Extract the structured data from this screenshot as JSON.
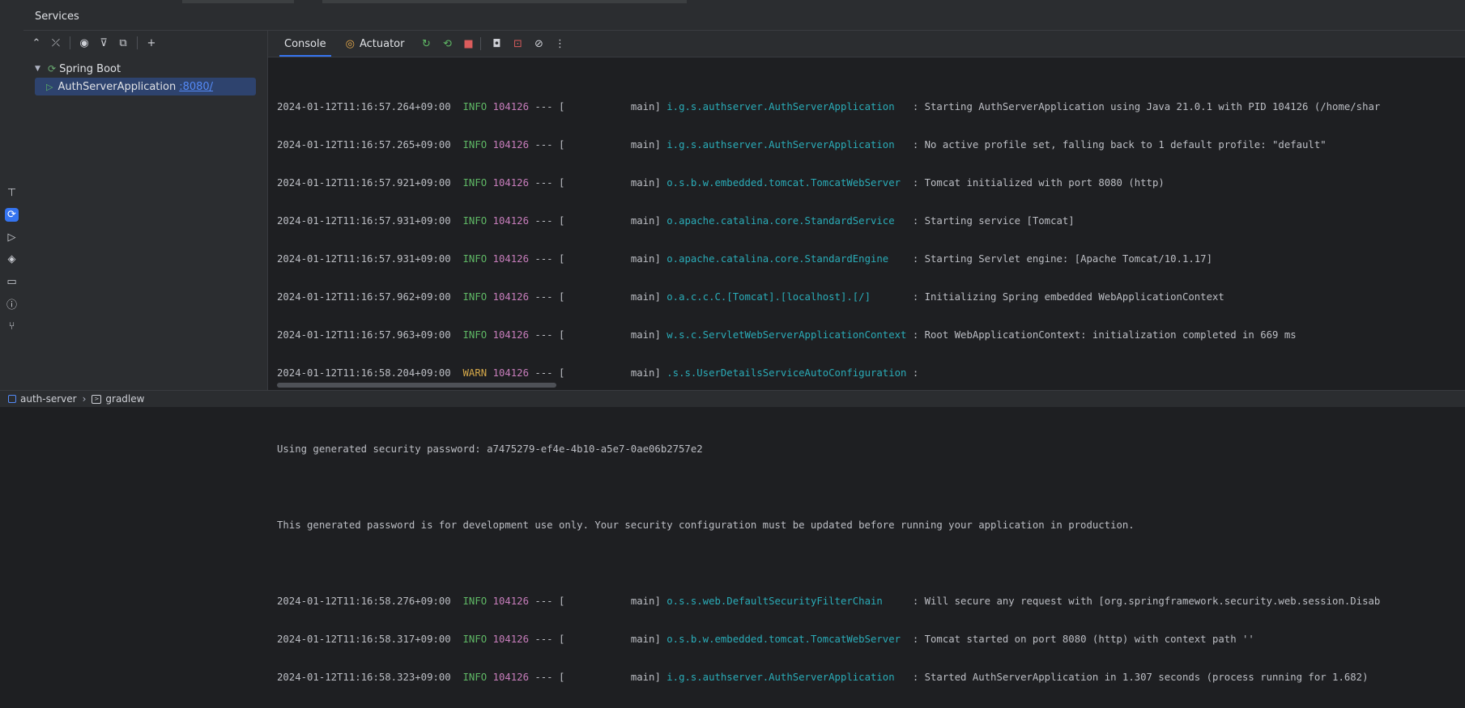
{
  "header": {
    "title": "Services"
  },
  "tree": {
    "root_label": "Spring Boot",
    "app_label": "AuthServerApplication",
    "app_port": ":8080/"
  },
  "tabs": {
    "console": "Console",
    "actuator": "Actuator"
  },
  "log_lines": [
    {
      "ts": "2024-01-12T11:16:57.264+09:00",
      "level": "INFO",
      "pid": "104126",
      "sep": "---",
      "thread": "[           main]",
      "logger": "i.g.s.authserver.AuthServerApplication  ",
      "msg": ": Starting AuthServerApplication using Java 21.0.1 with PID 104126 (/home/shar"
    },
    {
      "ts": "2024-01-12T11:16:57.265+09:00",
      "level": "INFO",
      "pid": "104126",
      "sep": "---",
      "thread": "[           main]",
      "logger": "i.g.s.authserver.AuthServerApplication  ",
      "msg": ": No active profile set, falling back to 1 default profile: \"default\""
    },
    {
      "ts": "2024-01-12T11:16:57.921+09:00",
      "level": "INFO",
      "pid": "104126",
      "sep": "---",
      "thread": "[           main]",
      "logger": "o.s.b.w.embedded.tomcat.TomcatWebServer ",
      "msg": ": Tomcat initialized with port 8080 (http)"
    },
    {
      "ts": "2024-01-12T11:16:57.931+09:00",
      "level": "INFO",
      "pid": "104126",
      "sep": "---",
      "thread": "[           main]",
      "logger": "o.apache.catalina.core.StandardService  ",
      "msg": ": Starting service [Tomcat]"
    },
    {
      "ts": "2024-01-12T11:16:57.931+09:00",
      "level": "INFO",
      "pid": "104126",
      "sep": "---",
      "thread": "[           main]",
      "logger": "o.apache.catalina.core.StandardEngine   ",
      "msg": ": Starting Servlet engine: [Apache Tomcat/10.1.17]"
    },
    {
      "ts": "2024-01-12T11:16:57.962+09:00",
      "level": "INFO",
      "pid": "104126",
      "sep": "---",
      "thread": "[           main]",
      "logger": "o.a.c.c.C.[Tomcat].[localhost].[/]      ",
      "msg": ": Initializing Spring embedded WebApplicationContext"
    },
    {
      "ts": "2024-01-12T11:16:57.963+09:00",
      "level": "INFO",
      "pid": "104126",
      "sep": "---",
      "thread": "[           main]",
      "logger": "w.s.c.ServletWebServerApplicationContext",
      "msg": ": Root WebApplicationContext: initialization completed in 669 ms"
    },
    {
      "ts": "2024-01-12T11:16:58.204+09:00",
      "level": "WARN",
      "pid": "104126",
      "sep": "---",
      "thread": "[           main]",
      "logger": ".s.s.UserDetailsServiceAutoConfiguration",
      "msg": ":"
    }
  ],
  "plain_lines": {
    "password": "Using generated security password: a7475279-ef4e-4b10-a5e7-0ae06b2757e2",
    "notice": "This generated password is for development use only. Your security configuration must be updated before running your application in production."
  },
  "log_lines_2": [
    {
      "ts": "2024-01-12T11:16:58.276+09:00",
      "level": "INFO",
      "pid": "104126",
      "sep": "---",
      "thread": "[           main]",
      "logger": "o.s.s.web.DefaultSecurityFilterChain    ",
      "msg": ": Will secure any request with [org.springframework.security.web.session.Disab"
    },
    {
      "ts": "2024-01-12T11:16:58.317+09:00",
      "level": "INFO",
      "pid": "104126",
      "sep": "---",
      "thread": "[           main]",
      "logger": "o.s.b.w.embedded.tomcat.TomcatWebServer ",
      "msg": ": Tomcat started on port 8080 (http) with context path ''"
    },
    {
      "ts": "2024-01-12T11:16:58.323+09:00",
      "level": "INFO",
      "pid": "104126",
      "sep": "---",
      "thread": "[           main]",
      "logger": "i.g.s.authserver.AuthServerApplication  ",
      "msg": ": Started AuthServerApplication in 1.307 seconds (process running for 1.682)"
    }
  ],
  "statusbar": {
    "project": "auth-server",
    "item": "gradlew"
  }
}
